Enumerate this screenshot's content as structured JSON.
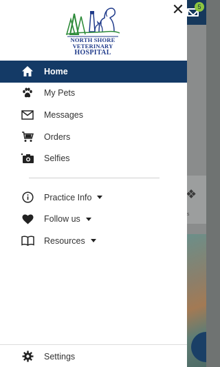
{
  "background": {
    "notification_count": "5",
    "card_caption": "gs"
  },
  "drawer": {
    "logo": {
      "line1": "NORTH SHORE",
      "line2": "VETERINARY",
      "line3": "HOSPITAL"
    },
    "primary_items": [
      {
        "label": "Home",
        "icon": "home-icon",
        "active": true
      },
      {
        "label": "My Pets",
        "icon": "paw-icon"
      },
      {
        "label": "Messages",
        "icon": "mail-icon"
      },
      {
        "label": "Orders",
        "icon": "cart-icon"
      },
      {
        "label": "Selfies",
        "icon": "camera-icon"
      }
    ],
    "secondary_items": [
      {
        "label": "Practice Info",
        "icon": "info-icon",
        "has_dropdown": true
      },
      {
        "label": "Follow us",
        "icon": "heart-icon",
        "has_dropdown": true
      },
      {
        "label": "Resources",
        "icon": "book-icon",
        "has_dropdown": true
      }
    ],
    "settings_label": "Settings"
  },
  "colors": {
    "active_bg": "#143a66",
    "logo_blue": "#1f3a8a",
    "logo_green": "#2e8b3a"
  }
}
